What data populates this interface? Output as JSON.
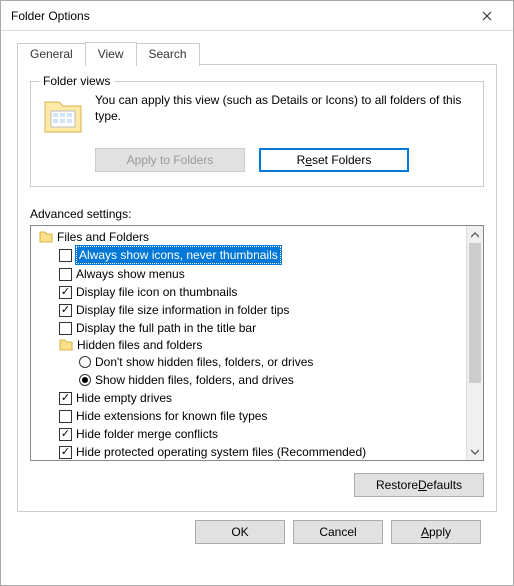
{
  "window": {
    "title": "Folder Options"
  },
  "tabs": {
    "general": "General",
    "view": "View",
    "search": "Search",
    "active": "view"
  },
  "folderViews": {
    "groupLabel": "Folder views",
    "description": "You can apply this view (such as Details or Icons) to all folders of this type.",
    "applyBtn": "Apply to Folders",
    "resetBtn_pre": "R",
    "resetBtn_u": "e",
    "resetBtn_post": "set Folders"
  },
  "advanced": {
    "label": "Advanced settings:",
    "rootGroup": "Files and Folders",
    "items": [
      {
        "type": "check",
        "checked": false,
        "label": "Always show icons, never thumbnails",
        "selected": true
      },
      {
        "type": "check",
        "checked": false,
        "label": "Always show menus"
      },
      {
        "type": "check",
        "checked": true,
        "label": "Display file icon on thumbnails"
      },
      {
        "type": "check",
        "checked": true,
        "label": "Display file size information in folder tips"
      },
      {
        "type": "check",
        "checked": false,
        "label": "Display the full path in the title bar"
      },
      {
        "type": "group",
        "label": "Hidden files and folders"
      },
      {
        "type": "radio",
        "checked": false,
        "label": "Don't show hidden files, folders, or drives"
      },
      {
        "type": "radio",
        "checked": true,
        "label": "Show hidden files, folders, and drives"
      },
      {
        "type": "check",
        "checked": true,
        "label": "Hide empty drives"
      },
      {
        "type": "check",
        "checked": false,
        "label": "Hide extensions for known file types"
      },
      {
        "type": "check",
        "checked": true,
        "label": "Hide folder merge conflicts"
      },
      {
        "type": "check",
        "checked": true,
        "label": "Hide protected operating system files (Recommended)"
      }
    ]
  },
  "restore_pre": "Restore ",
  "restore_u": "D",
  "restore_post": "efaults",
  "buttons": {
    "ok": "OK",
    "cancel": "Cancel",
    "apply_u": "A",
    "apply_post": "pply"
  }
}
